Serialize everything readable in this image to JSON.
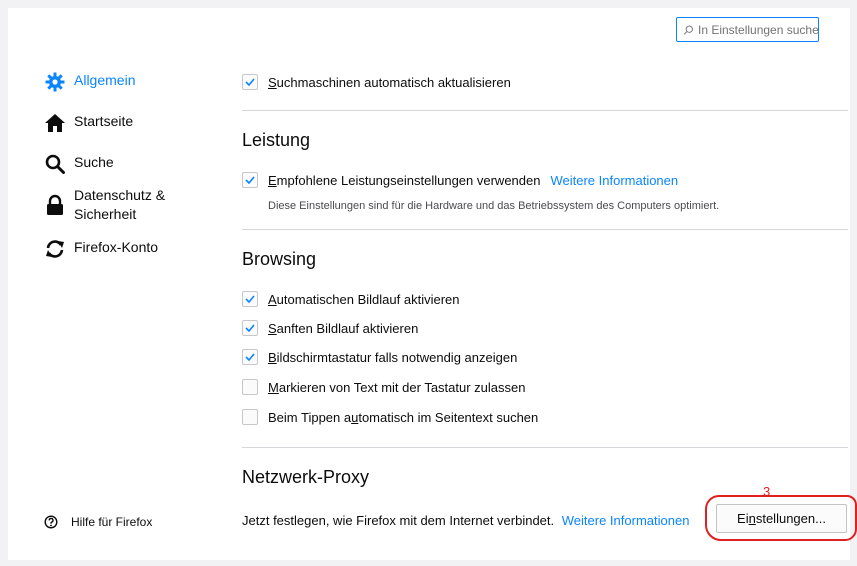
{
  "search": {
    "placeholder": "In Einstellungen suchen",
    "value": ""
  },
  "sidebar": {
    "items": [
      {
        "label": "Allgemein",
        "icon": "gear-icon",
        "active": true
      },
      {
        "label": "Startseite",
        "icon": "home-icon"
      },
      {
        "label": "Suche",
        "icon": "search-icon"
      },
      {
        "label": "Datenschutz &",
        "label2": "Sicherheit",
        "icon": "lock-icon"
      },
      {
        "label": "Firefox-Konto",
        "icon": "sync-icon"
      }
    ],
    "help": {
      "label": "Hilfe für Firefox",
      "icon": "help-icon"
    }
  },
  "general": {
    "auto_update_search": {
      "pre": "",
      "ul": "S",
      "post": "uchmaschinen automatisch aktualisieren",
      "checked": true
    }
  },
  "performance": {
    "heading": "Leistung",
    "recommended": {
      "pre": "",
      "ul": "E",
      "post": "mpfohlene Leistungseinstellungen verwenden",
      "checked": true
    },
    "link": "Weitere Informationen",
    "description": "Diese Einstellungen sind für die Hardware und das Betriebssystem des Computers optimiert."
  },
  "browsing": {
    "heading": "Browsing",
    "options": [
      {
        "pre": "",
        "ul": "A",
        "post": "utomatischen Bildlauf aktivieren",
        "checked": true
      },
      {
        "pre": "",
        "ul": "S",
        "post": "anften Bildlauf aktivieren",
        "checked": true
      },
      {
        "pre": "",
        "ul": "B",
        "post": "ildschirmtastatur falls notwendig anzeigen",
        "checked": true
      },
      {
        "pre": "",
        "ul": "M",
        "post": "arkieren von Text mit der Tastatur zulassen",
        "checked": false
      },
      {
        "pre": "Beim Tippen a",
        "ul": "u",
        "post": "tomatisch im Seitentext suchen",
        "checked": false
      }
    ]
  },
  "proxy": {
    "heading": "Netzwerk-Proxy",
    "text": "Jetzt festlegen, wie Firefox mit dem Internet verbindet.",
    "link": "Weitere Informationen",
    "button": {
      "pre": "Ei",
      "ul": "n",
      "post": "stellungen..."
    }
  },
  "annotation": {
    "number": "3",
    "color": "#e02020"
  },
  "colors": {
    "accent": "#0a84ff"
  }
}
